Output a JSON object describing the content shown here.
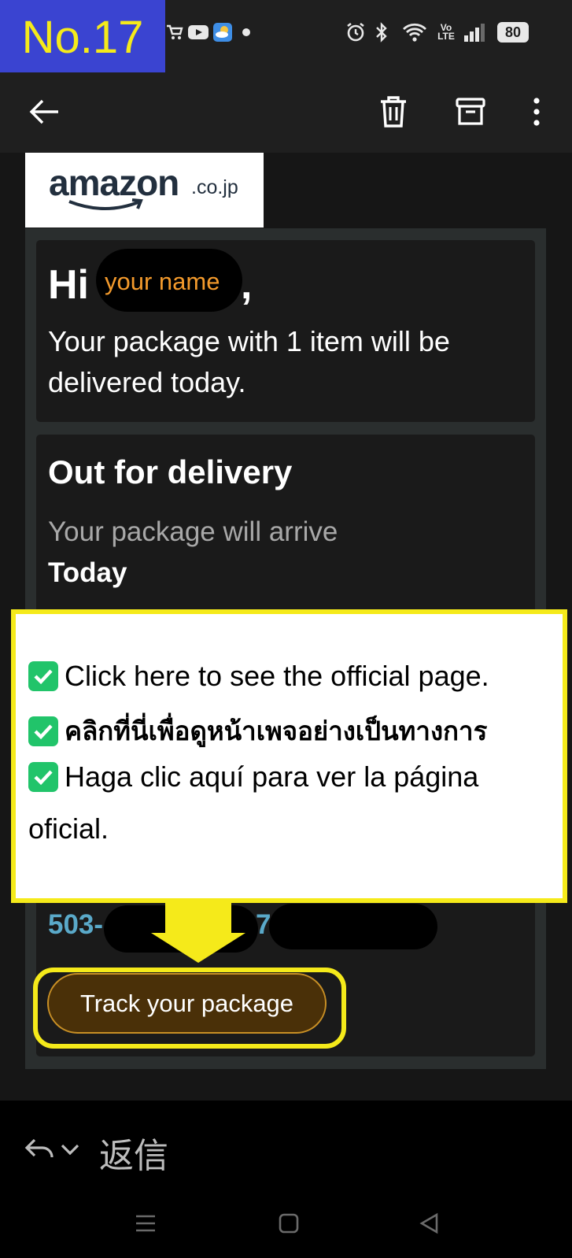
{
  "badge": {
    "label": "No.17"
  },
  "status_bar": {
    "battery": "80"
  },
  "brand": {
    "logo_text": "amazon",
    "logo_suffix": ".co.jp"
  },
  "greeting": {
    "hi": "Hi",
    "name_placeholder": "your name",
    "comma": ",",
    "message": "Your package with 1 item will be delivered today."
  },
  "delivery": {
    "title": "Out for delivery",
    "arrive_label": "Your package will arrive",
    "arrive_day": "Today"
  },
  "tracking": {
    "prefix": "503-",
    "fragment": "7"
  },
  "overlay": {
    "lines": [
      "Click here to see the official page.",
      "คลิกที่นี่เพื่อดูหน้าเพจอย่างเป็นทางการ",
      "Haga clic aquí para ver la página",
      "oficial."
    ]
  },
  "track_button": {
    "label": "Track your package"
  },
  "reply_bar": {
    "label": "返信"
  },
  "colors": {
    "badge_bg": "#3a44d1",
    "highlight": "#f5ea1a",
    "name_orange": "#f39a2c",
    "track_btn_bg": "#4a3008",
    "link_blue": "#5aa9c9",
    "check_green": "#21c46a"
  }
}
